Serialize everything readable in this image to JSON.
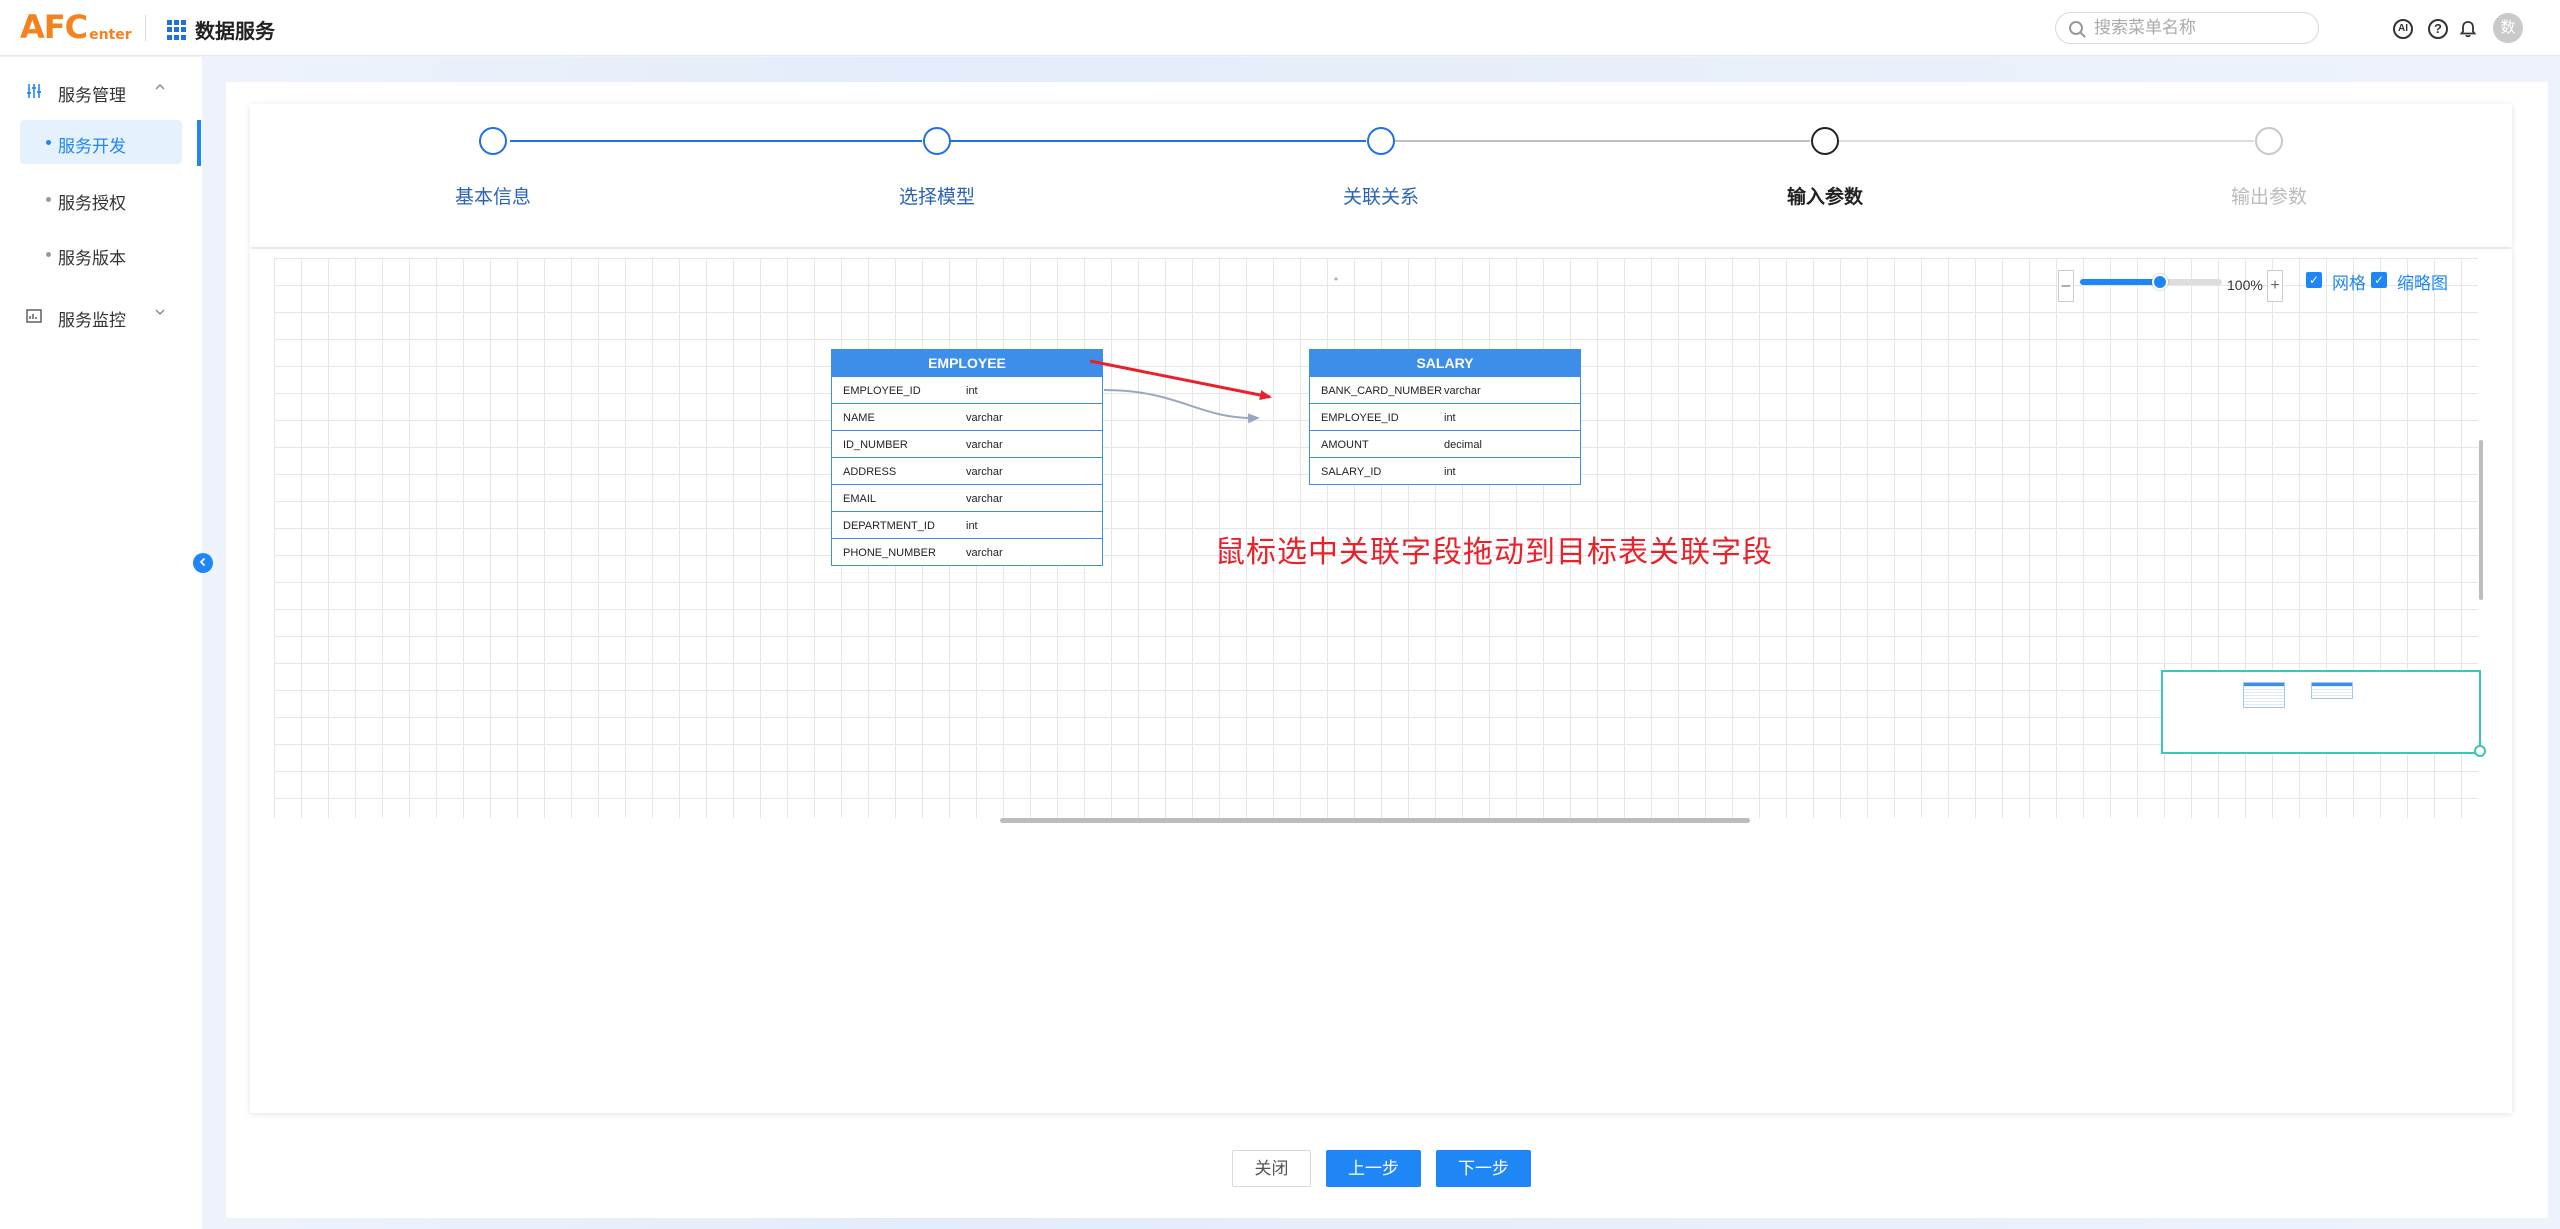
{
  "app": {
    "logo_big": "AFC",
    "logo_small": "enter",
    "title": "数据服务",
    "search_placeholder": "搜索菜单名称",
    "ai_label": "AI",
    "help_label": "?",
    "avatar_text": "数"
  },
  "sidebar": {
    "groups": [
      {
        "label": "服务管理",
        "expanded": true
      },
      {
        "label": "服务监控",
        "expanded": false
      }
    ],
    "items": [
      {
        "label": "服务开发",
        "active": true
      },
      {
        "label": "服务授权",
        "active": false
      },
      {
        "label": "服务版本",
        "active": false
      }
    ]
  },
  "steps": [
    {
      "label": "基本信息",
      "state": "done"
    },
    {
      "label": "选择模型",
      "state": "done"
    },
    {
      "label": "关联关系",
      "state": "done"
    },
    {
      "label": "输入参数",
      "state": "current"
    },
    {
      "label": "输出参数",
      "state": "pending"
    }
  ],
  "toolbar": {
    "zoom_minus": "–",
    "zoom_plus": "+",
    "zoom_value": "100%",
    "zoom_fraction": 0.56,
    "grid_label": "网格",
    "grid_checked": true,
    "minimap_label": "缩略图",
    "minimap_checked": true
  },
  "tables": [
    {
      "name": "EMPLOYEE",
      "fields": [
        {
          "name": "EMPLOYEE_ID",
          "type": "int"
        },
        {
          "name": "NAME",
          "type": "varchar"
        },
        {
          "name": "ID_NUMBER",
          "type": "varchar"
        },
        {
          "name": "ADDRESS",
          "type": "varchar"
        },
        {
          "name": "EMAIL",
          "type": "varchar"
        },
        {
          "name": "DEPARTMENT_ID",
          "type": "int"
        },
        {
          "name": "PHONE_NUMBER",
          "type": "varchar"
        }
      ]
    },
    {
      "name": "SALARY",
      "fields": [
        {
          "name": "BANK_CARD_NUMBER",
          "type": "varchar"
        },
        {
          "name": "EMPLOYEE_ID",
          "type": "int"
        },
        {
          "name": "AMOUNT",
          "type": "decimal"
        },
        {
          "name": "SALARY_ID",
          "type": "int"
        }
      ]
    }
  ],
  "annotation": "鼠标选中关联字段拖动到目标表关联字段",
  "colors": {
    "primary": "#1f87f5",
    "step_done": "#1f6fe5",
    "table_border": "#3c8ee8",
    "annotation": "#e8212a",
    "minimap_border": "#3ac7b7",
    "logo": "#f5821f"
  },
  "footer": {
    "close_label": "关闭",
    "prev_label": "上一步",
    "next_label": "下一步"
  }
}
